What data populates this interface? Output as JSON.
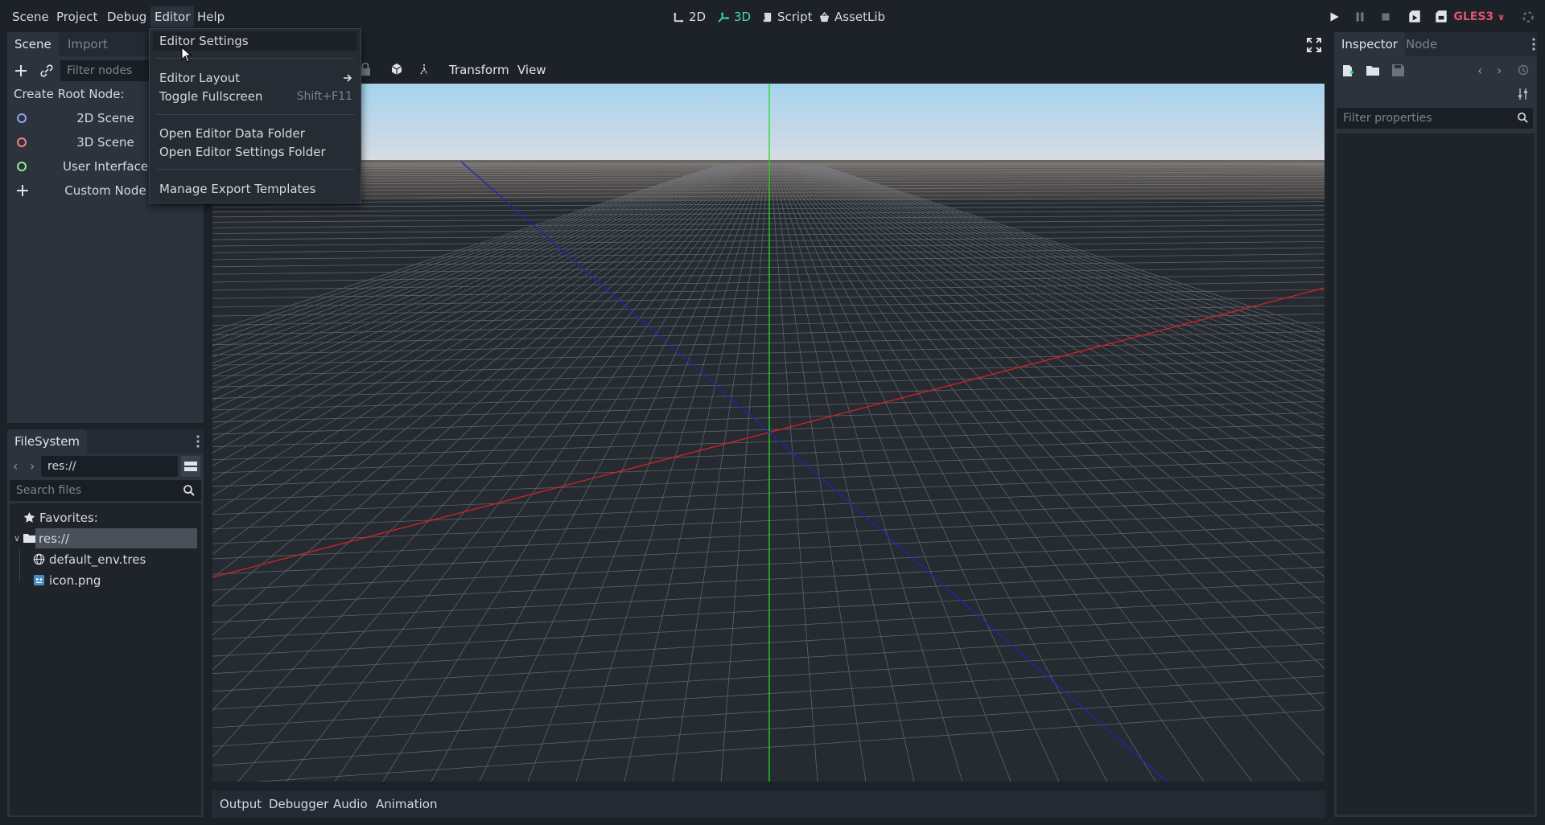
{
  "menubar": {
    "items": [
      "Scene",
      "Project",
      "Debug",
      "Editor",
      "Help"
    ]
  },
  "workspaces": {
    "2d": "2D",
    "3d": "3D",
    "script": "Script",
    "assetlib": "AssetLib"
  },
  "renderer": "GLES3",
  "scene_dock": {
    "tabs": [
      "Scene",
      "Import"
    ],
    "filter_placeholder": "Filter nodes",
    "create_root_label": "Create Root Node:",
    "root_options": [
      {
        "label": "2D Scene",
        "color": "#8da5f3"
      },
      {
        "label": "3D Scene",
        "color": "#fc7f7f"
      },
      {
        "label": "User Interface",
        "color": "#8eef97"
      },
      {
        "label": "Custom Node",
        "color": "#e0e0e0"
      }
    ]
  },
  "filesystem": {
    "tab": "FileSystem",
    "path": "res://",
    "search_placeholder": "Search files",
    "favorites_label": "Favorites:",
    "root_label": "res://",
    "files": [
      "default_env.tres",
      "icon.png"
    ]
  },
  "viewport_toolbar": {
    "transform_label": "Transform",
    "view_label": "View"
  },
  "bottom_panel": {
    "tabs": [
      "Output",
      "Debugger",
      "Audio",
      "Animation"
    ]
  },
  "inspector": {
    "tabs": [
      "Inspector",
      "Node"
    ],
    "filter_placeholder": "Filter properties"
  },
  "editor_menu": {
    "items": [
      {
        "label": "Editor Settings",
        "shortcut": "",
        "submenu": false
      },
      {
        "label": "Editor Layout",
        "shortcut": "",
        "submenu": true
      },
      {
        "label": "Toggle Fullscreen",
        "shortcut": "Shift+F11",
        "submenu": false
      },
      {
        "label": "Open Editor Data Folder",
        "shortcut": "",
        "submenu": false
      },
      {
        "label": "Open Editor Settings Folder",
        "shortcut": "",
        "submenu": false
      },
      {
        "label": "Manage Export Templates",
        "shortcut": "",
        "submenu": false
      }
    ]
  },
  "colors": {
    "accent": "#45d7a6",
    "renderer": "#e0536f",
    "axis_x": "#d02020",
    "axis_y": "#20d020",
    "axis_z": "#2020b0"
  }
}
